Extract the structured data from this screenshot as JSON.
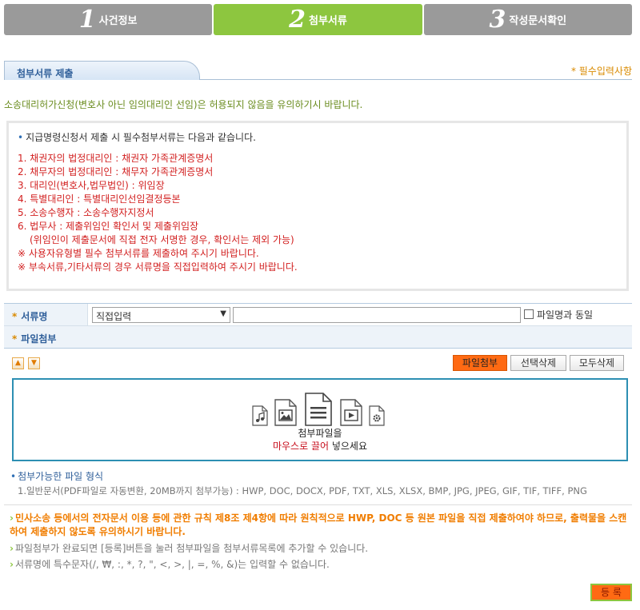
{
  "steps": [
    {
      "num": "1",
      "label": "사건정보"
    },
    {
      "num": "2",
      "label": "첨부서류"
    },
    {
      "num": "3",
      "label": "작성문서확인"
    }
  ],
  "section": {
    "title": "첨부서류 제출",
    "required_note": "* 필수입력사항"
  },
  "warning_top": "소송대리허가신청(변호사 아닌 임의대리인 선임)은 허용되지 않음을 유의하기시 바랍니다.",
  "info": {
    "heading": "지급명령신청서 제출 시 필수첨부서류는 다음과 같습니다.",
    "lines": [
      "1. 채권자의 법정대리인 : 채권자 가족관계증명서",
      "2. 채무자의 법정대리인 : 채무자 가족관계증명서",
      "3. 대리인(변호사,법무법인) : 위임장",
      "4. 특별대리인 : 특별대리인선임결정등본",
      "5. 소송수행자 : 소송수행자지정서",
      "6. 법무사 : 제출위임인 확인서 및 제출위임장",
      "(위임인이 제출문서에 직접 전자 서명한 경우, 확인서는 제외 가능)",
      "※ 사용자유형별 필수 첨부서류를 제출하여 주시기 바랍니다.",
      "※ 부속서류,기타서류의 경우 서류명을 직접입력하여 주시기 바랍니다."
    ]
  },
  "form": {
    "doc_label": "서류명",
    "doc_select": "직접입력",
    "doc_input_value": "",
    "same_as_filename": "파일명과 동일",
    "attach_label": "파일첨부"
  },
  "toolbar": {
    "attach": "파일첨부",
    "delete_selected": "선택삭제",
    "delete_all": "모두삭제"
  },
  "dropzone": {
    "line1": "첨부파일을",
    "line2_red": "마우스로 끌어",
    "line2_rest": " 넣으세요"
  },
  "formats": {
    "title": "첨부가능한 파일 형식",
    "list": "1.일반문서(PDF파일로 자동변환, 20MB까지 첨부가능) : HWP, DOC, DOCX, PDF, TXT, XLS, XLSX, BMP, JPG, JPEG, GIF, TIF, TIFF, PNG"
  },
  "notes": {
    "orange": "민사소송 등에서의 전자문서 이용 등에 관한 규칙 제8조 제4항에 따라 원칙적으로 HWP, DOC 등 원본 파일을 직접 제출하여야 하므로, 출력물을 스캔하여 제출하지 않도록 유의하시기 바랍니다.",
    "gray1": "파일첨부가 완료되면 [등록]버튼을 눌러 첨부파일을 첨부서류목록에 추가할 수 있습니다.",
    "gray2": "서류명에 특수문자(/, ₩, :, *, ?, \", <, >, |, =, %, &)는 입력할 수 없습니다."
  },
  "register": "등 록",
  "colors": {
    "active_step": "#8dc63f",
    "inactive_step": "#9a9a9a",
    "accent_orange": "#ff6a13",
    "warning_red": "#d21f1f"
  }
}
